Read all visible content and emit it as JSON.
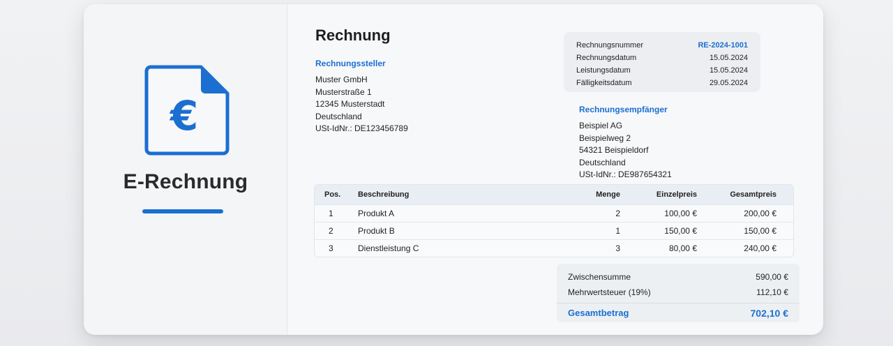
{
  "brand": {
    "title": "E-Rechnung",
    "icon": "euro-document-icon",
    "accent_color": "#1b6fd0"
  },
  "invoice": {
    "title": "Rechnung",
    "seller": {
      "heading": "Rechnungssteller",
      "lines": [
        "Muster GmbH",
        "Musterstraße 1",
        "12345 Musterstadt",
        "Deutschland",
        "USt-IdNr.: DE123456789"
      ]
    },
    "meta": [
      {
        "label": "Rechnungsnummer",
        "value": "RE-2024-1001"
      },
      {
        "label": "Rechnungsdatum",
        "value": "15.05.2024"
      },
      {
        "label": "Leistungsdatum",
        "value": "15.05.2024"
      },
      {
        "label": "Fälligkeitsdatum",
        "value": "29.05.2024"
      }
    ],
    "recipient": {
      "heading": "Rechnungsempfänger",
      "lines": [
        "Beispiel AG",
        "Beispielweg 2",
        "54321 Beispieldorf",
        "Deutschland",
        "USt-IdNr.: DE987654321"
      ]
    },
    "table": {
      "headers": {
        "pos": "Pos.",
        "desc": "Beschreibung",
        "qty": "Menge",
        "unit": "Einzelpreis",
        "total": "Gesamtpreis"
      },
      "rows": [
        {
          "pos": "1",
          "desc": "Produkt A",
          "qty": "2",
          "unit": "100,00 €",
          "total": "200,00 €"
        },
        {
          "pos": "2",
          "desc": "Produkt B",
          "qty": "1",
          "unit": "150,00 €",
          "total": "150,00 €"
        },
        {
          "pos": "3",
          "desc": "Dienstleistung C",
          "qty": "3",
          "unit": "80,00 €",
          "total": "240,00 €"
        }
      ]
    },
    "totals": {
      "subtotal_label": "Zwischensumme",
      "subtotal_value": "590,00 €",
      "vat_label": "Mehrwertsteuer (19%)",
      "vat_value": "112,10 €",
      "grand_label": "Gesamtbetrag",
      "grand_value": "702,10 €"
    }
  }
}
